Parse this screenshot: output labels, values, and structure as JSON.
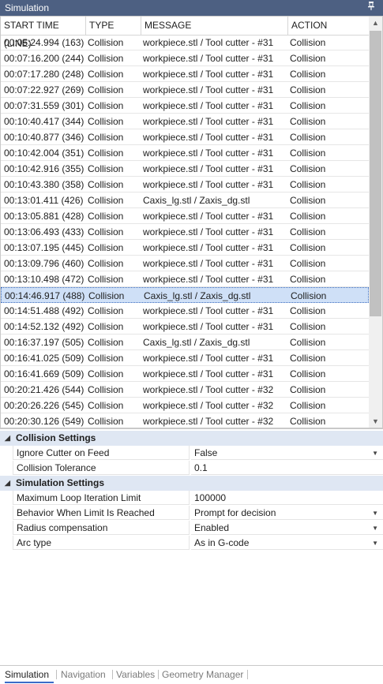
{
  "title": "Simulation",
  "columns": [
    "START TIME (LINE)",
    "TYPE",
    "MESSAGE",
    "ACTION"
  ],
  "rows": [
    [
      "00:05:24.994 (163)",
      "Collision",
      "workpiece.stl / Tool cutter - #31",
      "Collision"
    ],
    [
      "00:07:16.200 (244)",
      "Collision",
      "workpiece.stl / Tool cutter - #31",
      "Collision"
    ],
    [
      "00:07:17.280 (248)",
      "Collision",
      "workpiece.stl / Tool cutter - #31",
      "Collision"
    ],
    [
      "00:07:22.927 (269)",
      "Collision",
      "workpiece.stl / Tool cutter - #31",
      "Collision"
    ],
    [
      "00:07:31.559 (301)",
      "Collision",
      "workpiece.stl / Tool cutter - #31",
      "Collision"
    ],
    [
      "00:10:40.417 (344)",
      "Collision",
      "workpiece.stl / Tool cutter - #31",
      "Collision"
    ],
    [
      "00:10:40.877 (346)",
      "Collision",
      "workpiece.stl / Tool cutter - #31",
      "Collision"
    ],
    [
      "00:10:42.004 (351)",
      "Collision",
      "workpiece.stl / Tool cutter - #31",
      "Collision"
    ],
    [
      "00:10:42.916 (355)",
      "Collision",
      "workpiece.stl / Tool cutter - #31",
      "Collision"
    ],
    [
      "00:10:43.380 (358)",
      "Collision",
      "workpiece.stl / Tool cutter - #31",
      "Collision"
    ],
    [
      "00:13:01.411 (426)",
      "Collision",
      "Caxis_lg.stl / Zaxis_dg.stl",
      "Collision"
    ],
    [
      "00:13:05.881 (428)",
      "Collision",
      "workpiece.stl / Tool cutter - #31",
      "Collision"
    ],
    [
      "00:13:06.493 (433)",
      "Collision",
      "workpiece.stl / Tool cutter - #31",
      "Collision"
    ],
    [
      "00:13:07.195 (445)",
      "Collision",
      "workpiece.stl / Tool cutter - #31",
      "Collision"
    ],
    [
      "00:13:09.796 (460)",
      "Collision",
      "workpiece.stl / Tool cutter - #31",
      "Collision"
    ],
    [
      "00:13:10.498 (472)",
      "Collision",
      "workpiece.stl / Tool cutter - #31",
      "Collision"
    ],
    [
      "00:14:46.917 (488)",
      "Collision",
      "Caxis_lg.stl / Zaxis_dg.stl",
      "Collision"
    ],
    [
      "00:14:51.488 (492)",
      "Collision",
      "workpiece.stl / Tool cutter - #31",
      "Collision"
    ],
    [
      "00:14:52.132 (492)",
      "Collision",
      "workpiece.stl / Tool cutter - #31",
      "Collision"
    ],
    [
      "00:16:37.197 (505)",
      "Collision",
      "Caxis_lg.stl / Zaxis_dg.stl",
      "Collision"
    ],
    [
      "00:16:41.025 (509)",
      "Collision",
      "workpiece.stl / Tool cutter - #31",
      "Collision"
    ],
    [
      "00:16:41.669 (509)",
      "Collision",
      "workpiece.stl / Tool cutter - #31",
      "Collision"
    ],
    [
      "00:20:21.426 (544)",
      "Collision",
      "workpiece.stl / Tool cutter - #32",
      "Collision"
    ],
    [
      "00:20:26.226 (545)",
      "Collision",
      "workpiece.stl / Tool cutter - #32",
      "Collision"
    ],
    [
      "00:20:30.126 (549)",
      "Collision",
      "workpiece.stl / Tool cutter - #32",
      "Collision"
    ]
  ],
  "selected_row": 16,
  "categories": [
    {
      "label": "Collision Settings",
      "props": [
        {
          "name": "Ignore Cutter on Feed",
          "value": "False",
          "dropdown": true
        },
        {
          "name": "Collision Tolerance",
          "value": "0.1",
          "dropdown": false
        }
      ]
    },
    {
      "label": "Simulation Settings",
      "props": [
        {
          "name": "Maximum Loop Iteration Limit",
          "value": "100000",
          "dropdown": false
        },
        {
          "name": "Behavior When Limit Is Reached",
          "value": "Prompt for decision",
          "dropdown": true
        },
        {
          "name": "Radius compensation",
          "value": "Enabled",
          "dropdown": true
        },
        {
          "name": "Arc type",
          "value": "As in G-code",
          "dropdown": true
        }
      ]
    }
  ],
  "tabs": [
    "Simulation",
    "Navigation",
    "Variables",
    "Geometry Manager"
  ],
  "active_tab": 0,
  "icons": {
    "pin": "pin-icon",
    "collapse": "collapse-triangle-icon",
    "dropdown": "dropdown-arrow-icon",
    "scroll_up": "scroll-up-arrow-icon",
    "scroll_down": "scroll-down-arrow-icon"
  }
}
